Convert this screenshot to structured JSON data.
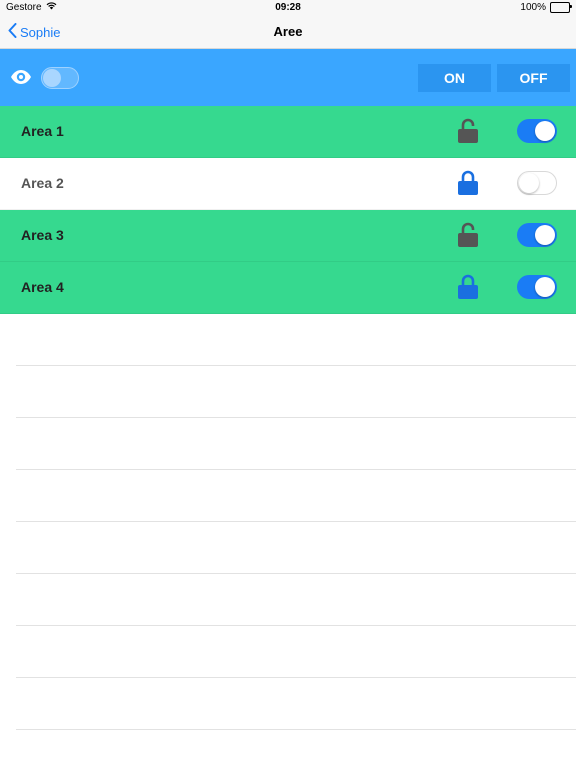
{
  "status_bar": {
    "carrier": "Gestore",
    "time": "09:28",
    "battery": "100%"
  },
  "nav": {
    "back_label": "Sophie",
    "title": "Aree"
  },
  "toolbar": {
    "on_label": "ON",
    "off_label": "OFF",
    "visibility_toggle": "off"
  },
  "areas": [
    {
      "label": "Area 1",
      "lock": "unlocked",
      "switch": "on",
      "highlighted": true
    },
    {
      "label": "Area 2",
      "lock": "locked",
      "switch": "off",
      "highlighted": false
    },
    {
      "label": "Area 3",
      "lock": "unlocked",
      "switch": "on",
      "highlighted": true
    },
    {
      "label": "Area 4",
      "lock": "locked",
      "switch": "on",
      "highlighted": true
    }
  ],
  "colors": {
    "toolbar_bg": "#3aa6ff",
    "highlight_row": "#36d98f",
    "accent": "#1a7cf5",
    "lock_locked": "#1a6fe0",
    "lock_unlocked": "#555555"
  },
  "icons": {
    "wifi": "wifi-icon",
    "battery": "battery-icon",
    "back": "chevron-left-icon",
    "eye": "eye-icon",
    "lock_locked": "lock-closed-icon",
    "lock_unlocked": "lock-open-icon"
  }
}
